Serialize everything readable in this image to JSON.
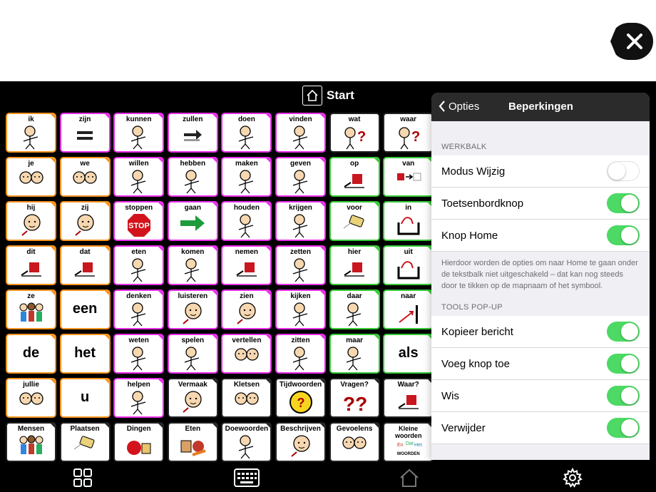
{
  "header": {
    "title": "Start"
  },
  "colors": {
    "orange": "#f5921e",
    "magenta": "#e62ee6",
    "green": "#37c837",
    "black": "#222222",
    "toggle_on": "#4cd964"
  },
  "grid": {
    "rows": [
      [
        {
          "label": "ik",
          "c": "orange",
          "icon": "person"
        },
        {
          "label": "zijn",
          "c": "magenta",
          "icon": "equals"
        },
        {
          "label": "kunnen",
          "c": "magenta",
          "icon": "person"
        },
        {
          "label": "zullen",
          "c": "magenta",
          "icon": "arrow-right"
        },
        {
          "label": "doen",
          "c": "magenta",
          "icon": "person"
        },
        {
          "label": "vinden",
          "c": "magenta",
          "icon": "person"
        },
        {
          "label": "wat",
          "c": "black",
          "icon": "question-person"
        },
        {
          "label": "waar",
          "c": "black",
          "icon": "question-person"
        }
      ],
      [
        {
          "label": "je",
          "c": "orange",
          "icon": "two-faces"
        },
        {
          "label": "we",
          "c": "orange",
          "icon": "two-faces"
        },
        {
          "label": "willen",
          "c": "magenta",
          "icon": "person"
        },
        {
          "label": "hebben",
          "c": "magenta",
          "icon": "person"
        },
        {
          "label": "maken",
          "c": "magenta",
          "icon": "person"
        },
        {
          "label": "geven",
          "c": "magenta",
          "icon": "person"
        },
        {
          "label": "op",
          "c": "green",
          "icon": "box"
        },
        {
          "label": "van",
          "c": "green",
          "icon": "arrow-box"
        }
      ],
      [
        {
          "label": "hij",
          "c": "orange",
          "icon": "face"
        },
        {
          "label": "zij",
          "c": "orange",
          "icon": "face"
        },
        {
          "label": "stoppen",
          "c": "magenta",
          "icon": "stop"
        },
        {
          "label": "gaan",
          "c": "magenta",
          "icon": "green-arrow"
        },
        {
          "label": "houden",
          "c": "magenta",
          "icon": "person"
        },
        {
          "label": "krijgen",
          "c": "magenta",
          "icon": "person"
        },
        {
          "label": "voor",
          "c": "green",
          "icon": "tag"
        },
        {
          "label": "in",
          "c": "green",
          "icon": "in"
        }
      ],
      [
        {
          "label": "dit",
          "c": "orange",
          "icon": "box"
        },
        {
          "label": "dat",
          "c": "orange",
          "icon": "box"
        },
        {
          "label": "eten",
          "c": "magenta",
          "icon": "person"
        },
        {
          "label": "komen",
          "c": "magenta",
          "icon": "person"
        },
        {
          "label": "nemen",
          "c": "magenta",
          "icon": "box"
        },
        {
          "label": "zetten",
          "c": "magenta",
          "icon": "person"
        },
        {
          "label": "hier",
          "c": "green",
          "icon": "box"
        },
        {
          "label": "uit",
          "c": "green",
          "icon": "in"
        }
      ],
      [
        {
          "label": "ze",
          "c": "orange",
          "icon": "group"
        },
        {
          "label": "een",
          "c": "orange",
          "big": true
        },
        {
          "label": "denken",
          "c": "magenta",
          "icon": "person"
        },
        {
          "label": "luisteren",
          "c": "magenta",
          "icon": "face"
        },
        {
          "label": "zien",
          "c": "magenta",
          "icon": "face"
        },
        {
          "label": "kijken",
          "c": "magenta",
          "icon": "person"
        },
        {
          "label": "daar",
          "c": "green",
          "icon": "person"
        },
        {
          "label": "naar",
          "c": "green",
          "icon": "arrow-up"
        }
      ],
      [
        {
          "label": "de",
          "c": "orange",
          "big": true
        },
        {
          "label": "het",
          "c": "orange",
          "big": true
        },
        {
          "label": "weten",
          "c": "magenta",
          "icon": "person"
        },
        {
          "label": "spelen",
          "c": "magenta",
          "icon": "person"
        },
        {
          "label": "vertellen",
          "c": "magenta",
          "icon": "two-faces"
        },
        {
          "label": "zitten",
          "c": "magenta",
          "icon": "person"
        },
        {
          "label": "maar",
          "c": "green",
          "icon": "person"
        },
        {
          "label": "als",
          "c": "green",
          "big": true
        }
      ],
      [
        {
          "label": "jullie",
          "c": "orange",
          "icon": "two-faces"
        },
        {
          "label": "u",
          "c": "orange",
          "big": true
        },
        {
          "label": "helpen",
          "c": "magenta",
          "icon": "person"
        },
        {
          "label": "Vermaak",
          "c": "black",
          "icon": "face"
        },
        {
          "label": "Kletsen",
          "c": "black",
          "icon": "two-faces"
        },
        {
          "label": "Tijdwoorden",
          "c": "black",
          "icon": "clock"
        },
        {
          "label": "Vragen?",
          "c": "black",
          "icon": "qq"
        },
        {
          "label": "Waar?",
          "c": "black",
          "icon": "box"
        }
      ],
      [
        {
          "label": "Mensen",
          "c": "black",
          "icon": "group"
        },
        {
          "label": "Plaatsen",
          "c": "black",
          "icon": "tag"
        },
        {
          "label": "Dingen",
          "c": "black",
          "icon": "ball"
        },
        {
          "label": "Eten",
          "c": "black",
          "icon": "food"
        },
        {
          "label": "Doewoorden",
          "c": "black",
          "icon": "person"
        },
        {
          "label": "Beschrijven",
          "c": "black",
          "icon": "face"
        },
        {
          "label": "Gevoelens",
          "c": "black",
          "icon": "two-faces"
        },
        {
          "label": "Kleine woorden",
          "c": "black",
          "icon": "words",
          "subtext": "WOORDEN"
        }
      ]
    ]
  },
  "panel": {
    "back_label": "Opties",
    "title": "Beperkingen",
    "section1": "WERKBALK",
    "toolbar_rows": [
      {
        "label": "Modus Wijzig",
        "on": false
      },
      {
        "label": "Toetsenbordknop",
        "on": true
      },
      {
        "label": "Knop Home",
        "on": true
      }
    ],
    "note": "Hierdoor worden de opties om naar Home te gaan onder de tekstbalk niet uitgeschakeld – dat kan nog steeds door te tikken op de mapnaam of het symbool.",
    "section2": "TOOLS POP-UP",
    "tools_rows": [
      {
        "label": "Kopieer bericht",
        "on": true
      },
      {
        "label": "Voeg knop toe",
        "on": true
      },
      {
        "label": "Wis",
        "on": true
      },
      {
        "label": "Verwijder",
        "on": true
      }
    ]
  }
}
